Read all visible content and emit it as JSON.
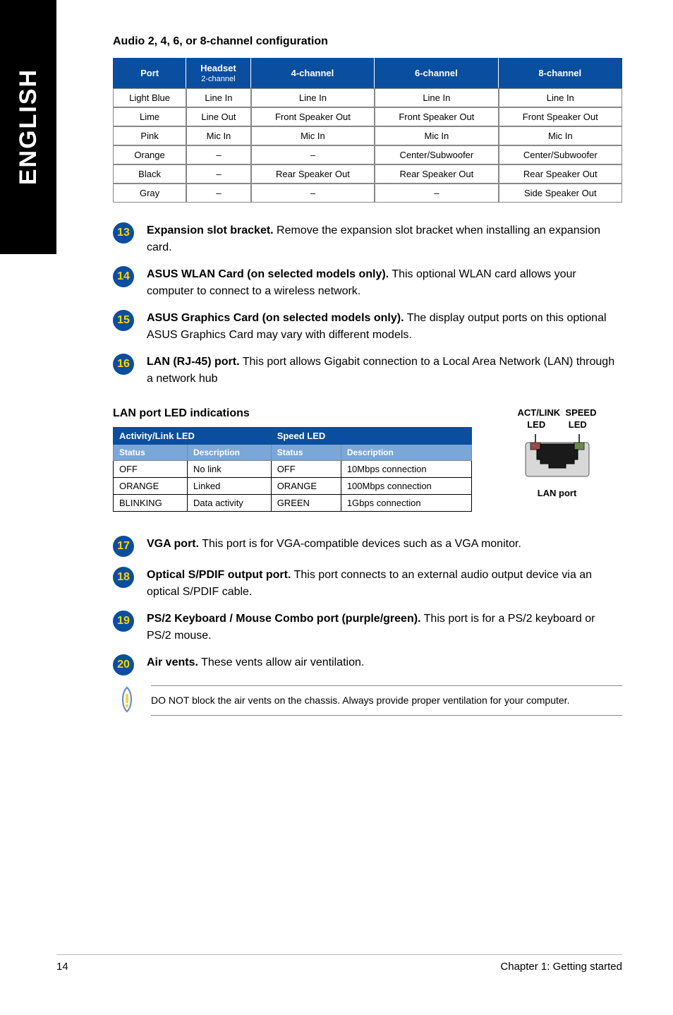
{
  "sidebar": {
    "label": "ENGLISH"
  },
  "audio_section": {
    "title": "Audio 2, 4, 6, or 8-channel configuration",
    "headers": {
      "port": "Port",
      "headset_line1": "Headset",
      "headset_line2": "2-channel",
      "c4": "4-channel",
      "c6": "6-channel",
      "c8": "8-channel"
    },
    "rows": [
      {
        "port": "Light Blue",
        "h": "Line In",
        "c4": "Line In",
        "c6": "Line In",
        "c8": "Line In"
      },
      {
        "port": "Lime",
        "h": "Line Out",
        "c4": "Front Speaker Out",
        "c6": "Front Speaker Out",
        "c8": "Front Speaker Out"
      },
      {
        "port": "Pink",
        "h": "Mic In",
        "c4": "Mic In",
        "c6": "Mic In",
        "c8": "Mic In"
      },
      {
        "port": "Orange",
        "h": "–",
        "c4": "–",
        "c6": "Center/Subwoofer",
        "c8": "Center/Subwoofer"
      },
      {
        "port": "Black",
        "h": "–",
        "c4": "Rear Speaker Out",
        "c6": "Rear Speaker Out",
        "c8": "Rear Speaker Out"
      },
      {
        "port": "Gray",
        "h": "–",
        "c4": "–",
        "c6": "–",
        "c8": "Side Speaker Out"
      }
    ]
  },
  "bullets1": [
    {
      "n": "13",
      "bold": "Expansion slot bracket.",
      "text": " Remove the expansion slot bracket when installing an expansion card."
    },
    {
      "n": "14",
      "bold": "ASUS WLAN Card (on selected models only).",
      "text": " This optional WLAN card allows your computer to connect to a wireless network."
    },
    {
      "n": "15",
      "bold": "ASUS Graphics Card (on selected models only).",
      "text": " The display output ports on this optional ASUS Graphics Card may vary with different models."
    },
    {
      "n": "16",
      "bold": "LAN (RJ-45) port.",
      "text": " This port allows Gigabit connection to a Local Area Network (LAN) through a network hub"
    }
  ],
  "lan": {
    "title": "LAN port LED indications",
    "group_headers": {
      "act": "Activity/Link LED",
      "speed": "Speed LED"
    },
    "sub_headers": {
      "status": "Status",
      "desc": "Description"
    },
    "rows": [
      {
        "s1": "OFF",
        "d1": "No link",
        "s2": "OFF",
        "d2": "10Mbps connection"
      },
      {
        "s1": "ORANGE",
        "d1": "Linked",
        "s2": "ORANGE",
        "d2": "100Mbps connection"
      },
      {
        "s1": "BLINKING",
        "d1": "Data activity",
        "s2": "GREEN",
        "d2": "1Gbps connection"
      }
    ],
    "diagram": {
      "top1": "ACT/LINK",
      "top2": "SPEED",
      "led": "LED",
      "port_label": "LAN port"
    }
  },
  "bullets2": [
    {
      "n": "17",
      "bold": "VGA port.",
      "text": " This port is for VGA-compatible devices such as a VGA monitor."
    },
    {
      "n": "18",
      "bold": "Optical S/PDIF output port.",
      "text": " This port connects to an external audio output device via an optical S/PDIF cable."
    },
    {
      "n": "19",
      "bold": "PS/2 Keyboard / Mouse Combo port (purple/green).",
      "text": " This port is for a PS/2 keyboard or PS/2 mouse."
    },
    {
      "n": "20",
      "bold": "Air vents.",
      "text": " These vents allow air ventilation."
    }
  ],
  "note": "DO NOT block the air vents on the chassis. Always provide proper ventilation for your computer.",
  "footer": {
    "page": "14",
    "chapter": "Chapter 1: Getting started"
  }
}
